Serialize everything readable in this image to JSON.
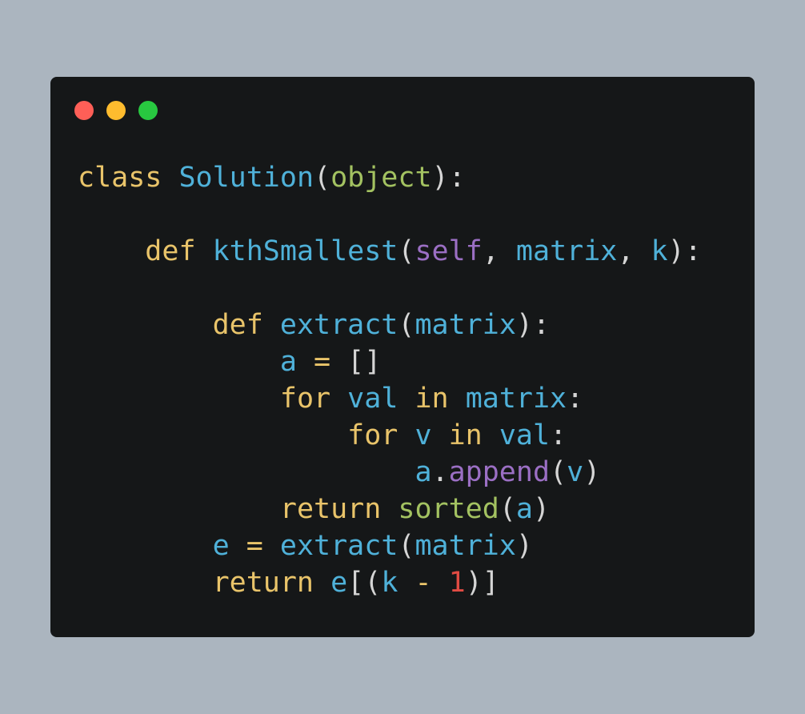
{
  "window": {
    "controls": [
      {
        "name": "close",
        "color": "#ff5f57"
      },
      {
        "name": "minimize",
        "color": "#febc2e"
      },
      {
        "name": "zoom",
        "color": "#28c840"
      }
    ]
  },
  "colors": {
    "keyword": "#e9c46a",
    "name": "#4fb1d9",
    "builtin": "#a3c261",
    "self": "#9b6fc4",
    "number": "#e14b43",
    "punct": "#d5d5d5"
  },
  "code": {
    "lines": [
      [
        {
          "t": "class",
          "c": "keyword"
        },
        {
          "t": " ",
          "c": "punct"
        },
        {
          "t": "Solution",
          "c": "name"
        },
        {
          "t": "(",
          "c": "punct"
        },
        {
          "t": "object",
          "c": "builtin"
        },
        {
          "t": "):",
          "c": "punct"
        }
      ],
      [],
      [
        {
          "t": "    ",
          "c": "punct"
        },
        {
          "t": "def",
          "c": "keyword"
        },
        {
          "t": " ",
          "c": "punct"
        },
        {
          "t": "kthSmallest",
          "c": "name"
        },
        {
          "t": "(",
          "c": "punct"
        },
        {
          "t": "self",
          "c": "self"
        },
        {
          "t": ", ",
          "c": "punct"
        },
        {
          "t": "matrix",
          "c": "name"
        },
        {
          "t": ", ",
          "c": "punct"
        },
        {
          "t": "k",
          "c": "name"
        },
        {
          "t": "):",
          "c": "punct"
        }
      ],
      [],
      [
        {
          "t": "        ",
          "c": "punct"
        },
        {
          "t": "def",
          "c": "keyword"
        },
        {
          "t": " ",
          "c": "punct"
        },
        {
          "t": "extract",
          "c": "name"
        },
        {
          "t": "(",
          "c": "punct"
        },
        {
          "t": "matrix",
          "c": "name"
        },
        {
          "t": "):",
          "c": "punct"
        }
      ],
      [
        {
          "t": "            ",
          "c": "punct"
        },
        {
          "t": "a",
          "c": "name"
        },
        {
          "t": " ",
          "c": "punct"
        },
        {
          "t": "=",
          "c": "keyword"
        },
        {
          "t": " []",
          "c": "punct"
        }
      ],
      [
        {
          "t": "            ",
          "c": "punct"
        },
        {
          "t": "for",
          "c": "keyword"
        },
        {
          "t": " ",
          "c": "punct"
        },
        {
          "t": "val",
          "c": "name"
        },
        {
          "t": " ",
          "c": "punct"
        },
        {
          "t": "in",
          "c": "keyword"
        },
        {
          "t": " ",
          "c": "punct"
        },
        {
          "t": "matrix",
          "c": "name"
        },
        {
          "t": ":",
          "c": "punct"
        }
      ],
      [
        {
          "t": "                ",
          "c": "punct"
        },
        {
          "t": "for",
          "c": "keyword"
        },
        {
          "t": " ",
          "c": "punct"
        },
        {
          "t": "v",
          "c": "name"
        },
        {
          "t": " ",
          "c": "punct"
        },
        {
          "t": "in",
          "c": "keyword"
        },
        {
          "t": " ",
          "c": "punct"
        },
        {
          "t": "val",
          "c": "name"
        },
        {
          "t": ":",
          "c": "punct"
        }
      ],
      [
        {
          "t": "                    ",
          "c": "punct"
        },
        {
          "t": "a",
          "c": "name"
        },
        {
          "t": ".",
          "c": "punct"
        },
        {
          "t": "append",
          "c": "self"
        },
        {
          "t": "(",
          "c": "punct"
        },
        {
          "t": "v",
          "c": "name"
        },
        {
          "t": ")",
          "c": "punct"
        }
      ],
      [
        {
          "t": "            ",
          "c": "punct"
        },
        {
          "t": "return",
          "c": "keyword"
        },
        {
          "t": " ",
          "c": "punct"
        },
        {
          "t": "sorted",
          "c": "builtin"
        },
        {
          "t": "(",
          "c": "punct"
        },
        {
          "t": "a",
          "c": "name"
        },
        {
          "t": ")",
          "c": "punct"
        }
      ],
      [
        {
          "t": "        ",
          "c": "punct"
        },
        {
          "t": "e",
          "c": "name"
        },
        {
          "t": " ",
          "c": "punct"
        },
        {
          "t": "=",
          "c": "keyword"
        },
        {
          "t": " ",
          "c": "punct"
        },
        {
          "t": "extract",
          "c": "name"
        },
        {
          "t": "(",
          "c": "punct"
        },
        {
          "t": "matrix",
          "c": "name"
        },
        {
          "t": ")",
          "c": "punct"
        }
      ],
      [
        {
          "t": "        ",
          "c": "punct"
        },
        {
          "t": "return",
          "c": "keyword"
        },
        {
          "t": " ",
          "c": "punct"
        },
        {
          "t": "e",
          "c": "name"
        },
        {
          "t": "[(",
          "c": "punct"
        },
        {
          "t": "k",
          "c": "name"
        },
        {
          "t": " ",
          "c": "punct"
        },
        {
          "t": "-",
          "c": "keyword"
        },
        {
          "t": " ",
          "c": "punct"
        },
        {
          "t": "1",
          "c": "number"
        },
        {
          "t": ")]",
          "c": "punct"
        }
      ]
    ]
  }
}
